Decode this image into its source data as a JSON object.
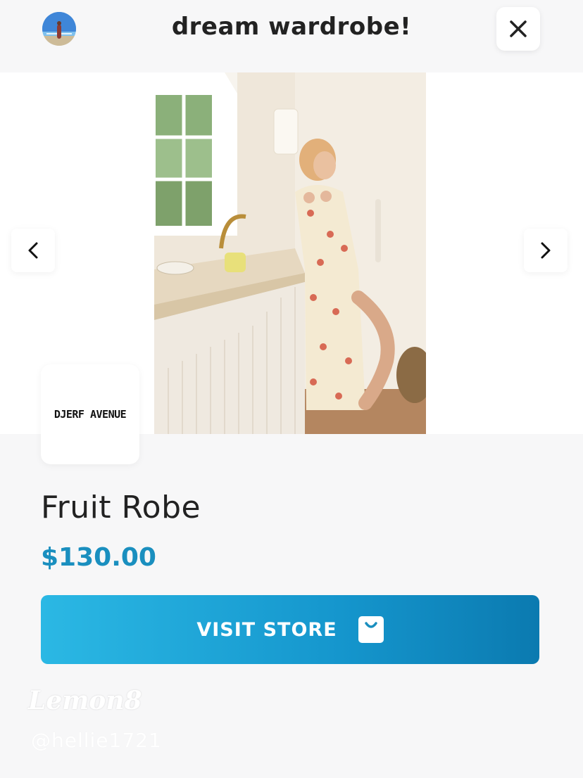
{
  "header": {
    "title": "dream wardrobe!",
    "avatar_icon": "user-avatar",
    "close_icon": "close-icon"
  },
  "gallery": {
    "prev_icon": "chevron-left-icon",
    "next_icon": "chevron-right-icon",
    "photo_description": "product-photo"
  },
  "product": {
    "brand": "DJERF AVENUE",
    "name": "Fruit Robe",
    "price": "$130.00",
    "cta_label": "VISIT STORE",
    "cta_icon": "shopping-bag-icon"
  },
  "watermark": {
    "logo": "Lemon8",
    "username": "@hellie1721"
  },
  "colors": {
    "price": "#1a8fbf",
    "cta_start": "#2bb8e4",
    "cta_end": "#0b7ab0",
    "background": "#f7f7f8"
  }
}
